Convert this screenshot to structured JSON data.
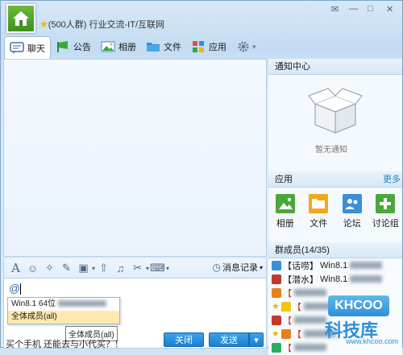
{
  "title": {
    "group_name": "",
    "group_desc": "(500人群) 行业交流-IT/互联网",
    "controls": [
      "✉",
      "—",
      "□",
      "✕"
    ]
  },
  "tabs": [
    {
      "label": "聊天",
      "icon": "chat-bubble-icon",
      "active": true
    },
    {
      "label": "公告",
      "icon": "megaphone-icon"
    },
    {
      "label": "相册",
      "icon": "photo-album-icon"
    },
    {
      "label": "文件",
      "icon": "folder-icon"
    },
    {
      "label": "应用",
      "icon": "apps-grid-icon"
    }
  ],
  "notice_center": {
    "title": "通知中心",
    "empty_text": "暂无通知"
  },
  "apps": {
    "title": "应用",
    "more_label": "更多",
    "items": [
      {
        "label": "相册",
        "color": "#4aa83a"
      },
      {
        "label": "文件",
        "color": "#f2a81a"
      },
      {
        "label": "论坛",
        "color": "#3a8fd9"
      },
      {
        "label": "讨论组",
        "color": "#4aa83a"
      }
    ]
  },
  "members": {
    "title": "群成员(14/35)",
    "list": [
      {
        "tag": "【话唠】",
        "name": "Win8.1",
        "icon_color": "#3a8fd9"
      },
      {
        "tag": "【潜水】",
        "name": "Win8.1",
        "icon_color": "#c0392b"
      },
      {
        "tag": "【",
        "name": "",
        "icon_color": "#e67e22"
      },
      {
        "tag": "【",
        "name": "",
        "icon_color": "#f1c40f"
      },
      {
        "tag": "【",
        "name": "",
        "icon_color": "#c0392b"
      },
      {
        "tag": "【",
        "name": "",
        "icon_color": "#e67e22"
      },
      {
        "tag": "【",
        "name": "",
        "icon_color": "#27ae60"
      }
    ]
  },
  "input": {
    "history_label": "消息记录",
    "at_sign": "@",
    "typed_text": "买个手机 还能去与小代买？！",
    "close_label": "关闭",
    "send_label": "发送",
    "send_arrow": "▾"
  },
  "mention": {
    "rows": [
      "Win8.1 64位",
      "全体成员(all)"
    ],
    "tooltip": "全体成员(all)"
  },
  "watermark": {
    "logo": "KHCOO",
    "text": "科技库",
    "url": "www.khcoo.com"
  }
}
